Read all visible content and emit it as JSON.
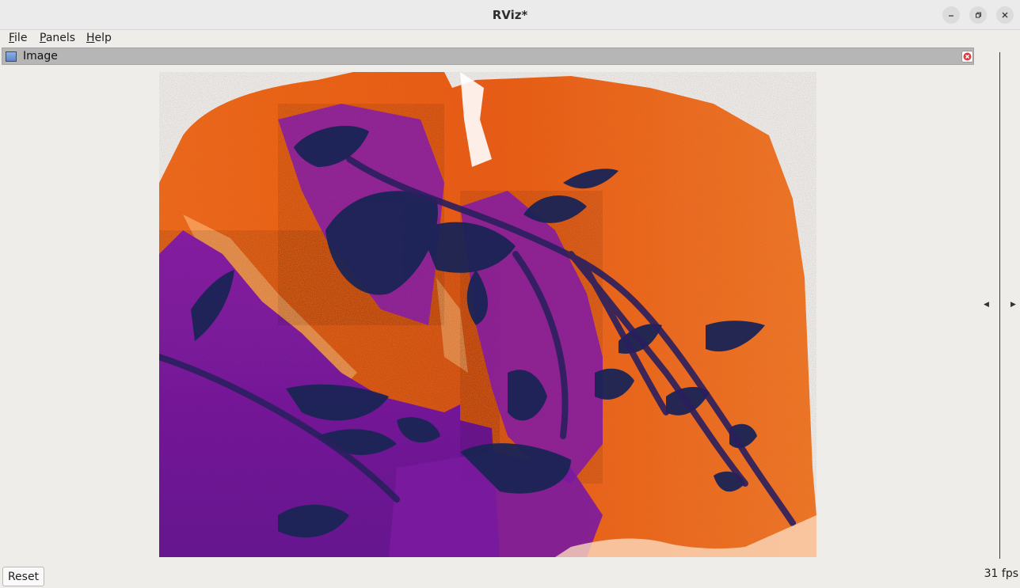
{
  "window": {
    "title": "RViz*",
    "minimize_icon": "minimize-icon",
    "maximize_icon": "restore-icon",
    "close_icon": "close-icon"
  },
  "menu": {
    "items": [
      {
        "label": "File",
        "accel": "F",
        "rest": "ile"
      },
      {
        "label": "Panels",
        "accel": "P",
        "rest": "anels"
      },
      {
        "label": "Help",
        "accel": "H",
        "rest": "elp"
      }
    ]
  },
  "panel": {
    "title": "Image",
    "icon": "image-panel-icon",
    "close_icon": "panel-close-icon"
  },
  "image": {
    "description_icon": "thermal-camera-image",
    "colors": {
      "background": "#fdf9f6",
      "orange": "#f26a1b",
      "orange_light": "#f7984f",
      "purple": "#7c1aa3",
      "purple_deep": "#4a1580",
      "navy": "#13244f"
    }
  },
  "footer": {
    "reset_label": "Reset",
    "fps_label": "31 fps"
  },
  "colors": {
    "titlebar_bg": "#ebebeb",
    "panel_header_bg": "#b6b6b6",
    "window_bg": "#efedea"
  }
}
